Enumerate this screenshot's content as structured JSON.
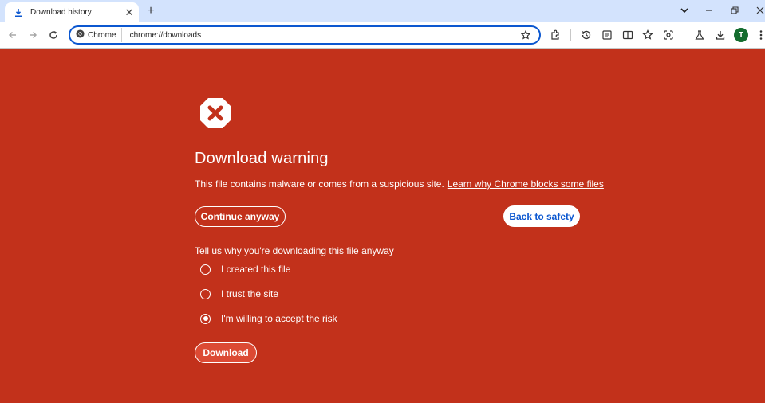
{
  "tab": {
    "title": "Download history",
    "icon": "download-icon"
  },
  "omnibox": {
    "chip_label": "Chrome",
    "url": "chrome://downloads"
  },
  "avatar": {
    "letter": "T"
  },
  "warning": {
    "title": "Download warning",
    "description": "This file contains malware or comes from a suspicious site.",
    "learn_link": "Learn why Chrome blocks some files",
    "continue_label": "Continue anyway",
    "safety_label": "Back to safety",
    "reason_prompt": "Tell us why you're downloading this file anyway",
    "options": [
      {
        "label": "I created this file",
        "checked": false
      },
      {
        "label": "I trust the site",
        "checked": false
      },
      {
        "label": "I'm willing to accept the risk",
        "checked": true
      }
    ],
    "download_label": "Download"
  },
  "colors": {
    "page_bg": "#c2311b",
    "accent": "#0b57d0",
    "tabstrip_bg": "#d3e3fd"
  }
}
